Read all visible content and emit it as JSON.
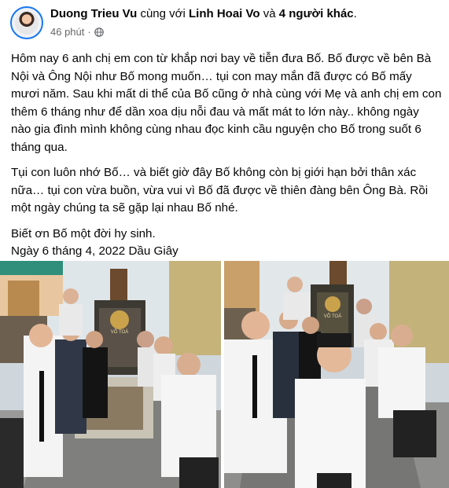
{
  "post": {
    "author": "Duong Trieu Vu",
    "with_word": "cùng với",
    "tagged": "Linh Hoai Vo",
    "and_word": "và",
    "others": "4 người khác",
    "end_punct": ".",
    "time": "46 phút",
    "separator": "·",
    "privacy_icon": "globe-icon",
    "paragraphs": [
      "Hôm nay 6 anh chị em con từ khắp nơi bay về tiễn đưa Bố.  Bố được về bên Bà Nội và Ông Nội như Bố mong muốn… tụi con may mắn đã được có Bố mấy mươi năm.  Sau khi mất di thể của Bố cũng ở nhà cùng với Mẹ và anh chị em con thêm 6 tháng như để dần xoa dịu nỗi đau và mất mát to lớn này.. không ngày nào gia đình mình không cùng nhau đọc kinh cầu nguyện cho Bố trong suốt 6 tháng qua.",
      "Tụi con luôn nhớ Bố… và biết giờ đây Bố không còn bị giới hạn bởi thân xác nữa… tụi con vừa buồn, vừa vui vì Bố đã được về thiên đàng bên Ông Bà.  Rồi một ngày chúng ta sẽ gặp lại nhau Bố nhé."
    ],
    "closing_line1": "Biết ơn Bố một đời hy sinh.",
    "closing_line2": "Ngày 6 tháng 4, 2022 Dầu Giây"
  },
  "photos": {
    "left_memorial_text": "VÕ TOÀ",
    "right_memorial_text": "VÕ TOÀ"
  },
  "colors": {
    "name": "#050505",
    "meta": "#65676b",
    "accent": "#1877f2"
  }
}
